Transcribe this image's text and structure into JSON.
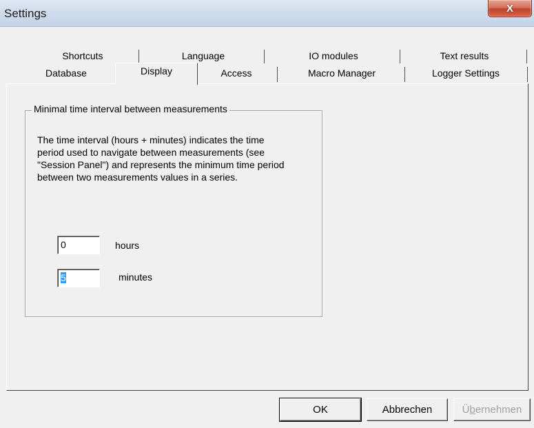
{
  "window": {
    "title": "Settings",
    "close_glyph": "X"
  },
  "tabs": {
    "row_top": [
      "Shortcuts",
      "Language",
      "IO modules",
      "Text results"
    ],
    "row_bottom": [
      "Database",
      "Display",
      "Access",
      "Macro Manager",
      "Logger Settings"
    ],
    "selected": "Display"
  },
  "group": {
    "caption": "Minimal time interval between measurements",
    "description": "The time interval (hours + minutes) indicates the time period used to navigate between measurements (see \"Session Panel\") and represents the minimum time period between two measurements values in a series.",
    "hours_value": "0",
    "hours_label": "hours",
    "minutes_value": "5",
    "minutes_label": "minutes"
  },
  "buttons": {
    "ok": "OK",
    "cancel": "Abbrechen",
    "apply_prefix": "Ü",
    "apply_accel": "b",
    "apply_suffix": "ernehmen"
  },
  "colors": {
    "face": "#f0f0f0",
    "selection": "#3399ff",
    "close": "#c0442c"
  },
  "icons": {
    "close": "close-icon"
  }
}
